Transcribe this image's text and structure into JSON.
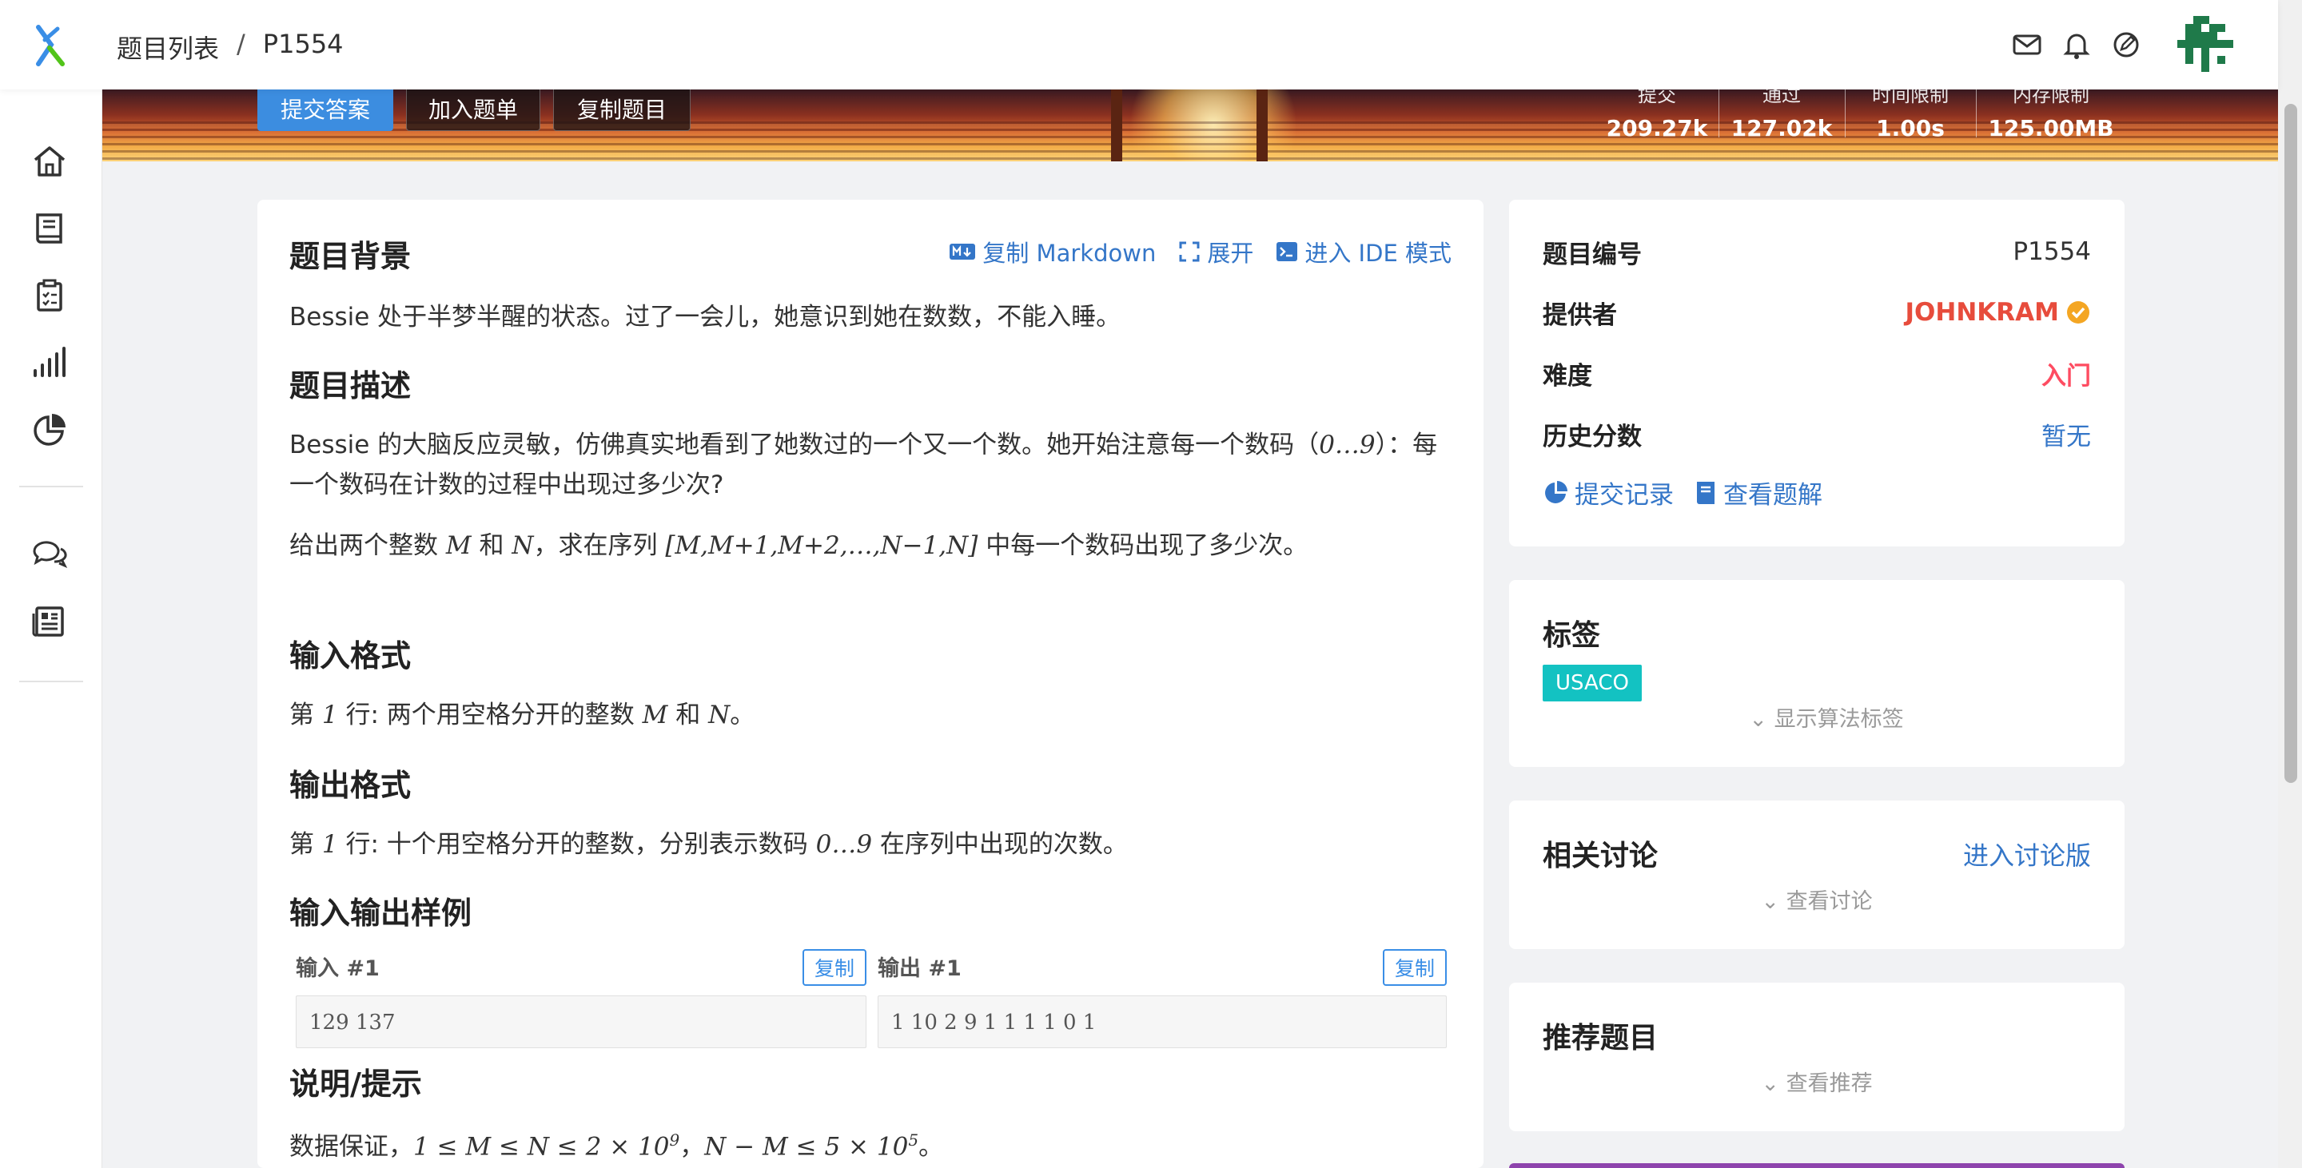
{
  "header": {
    "breadcrumb_list": "题目列表",
    "breadcrumb_sep": "/",
    "breadcrumb_current": "P1554",
    "icons": [
      "mail-icon",
      "bell-icon",
      "edit-icon"
    ]
  },
  "sidebar": {
    "items": [
      "home-icon",
      "book-icon",
      "clipboard-icon",
      "ranking-icon",
      "pie-chart-icon",
      "chat-icon",
      "news-icon"
    ]
  },
  "banner": {
    "submit_label": "提交答案",
    "add_list_label": "加入题单",
    "copy_problem_label": "复制题目",
    "stats": [
      {
        "label": "提交",
        "value": "209.27k"
      },
      {
        "label": "通过",
        "value": "127.02k"
      },
      {
        "label": "时间限制",
        "value": "1.00s"
      },
      {
        "label": "内存限制",
        "value": "125.00MB"
      }
    ]
  },
  "problem": {
    "toolbar": {
      "copy_markdown": "复制 Markdown",
      "expand": "展开",
      "ide_mode": "进入 IDE 模式"
    },
    "background_title": "题目背景",
    "background_text": "Bessie 处于半梦半醒的状态。过了一会儿，她意识到她在数数，不能入睡。",
    "description_title": "题目描述",
    "description_p1_a": "Bessie 的大脑反应灵敏，仿佛真实地看到了她数过的一个又一个数。她开始注意每一个数码（",
    "description_p1_math": "0…9",
    "description_p1_b": "）：每一个数码在计数的过程中出现过多少次?",
    "description_p2_a": "给出两个整数 ",
    "description_p2_m": "M",
    "description_p2_and": " 和 ",
    "description_p2_n": "N",
    "description_p2_b": "，求在序列 ",
    "description_p2_seq": "[M,M+1,M+2,…,N−1,N]",
    "description_p2_c": " 中每一个数码出现了多少次。",
    "input_title": "输入格式",
    "input_a": "第 ",
    "input_one": "1",
    "input_b": " 行: 两个用空格分开的整数 ",
    "input_m": "M",
    "input_and": " 和 ",
    "input_n": "N",
    "input_end": "。",
    "output_title": "输出格式",
    "output_a": "第 ",
    "output_one": "1",
    "output_b": " 行: 十个用空格分开的整数，分别表示数码 ",
    "output_math": "0…9",
    "output_c": " 在序列中出现的次数。",
    "samples_title": "输入输出样例",
    "input_label": "输入 #1",
    "output_label": "输出 #1",
    "copy_label": "复制",
    "input_value": "129 137",
    "output_value": "1 10 2 9 1 1 1 1 0 1",
    "hint_title": "说明/提示",
    "hint_a": "数据保证，",
    "hint_math1": "1 ≤ M ≤ N ≤ 2 × 10",
    "hint_sup1": "9",
    "hint_sep": "，",
    "hint_math2": "N − M ≤ 5 × 10",
    "hint_sup2": "5",
    "hint_end": "。"
  },
  "info": {
    "id_label": "题目编号",
    "id_value": "P1554",
    "provider_label": "提供者",
    "provider_value": "JOHNKRAM",
    "difficulty_label": "难度",
    "difficulty_value": "入门",
    "score_label": "历史分数",
    "score_value": "暂无",
    "records_link": "提交记录",
    "solutions_link": "查看题解"
  },
  "tags": {
    "title": "标签",
    "items": [
      "USACO"
    ],
    "show_algo": "显示算法标签"
  },
  "discuss": {
    "title": "相关讨论",
    "enter": "进入讨论版",
    "view": "查看讨论"
  },
  "recommend": {
    "title": "推荐题目",
    "view": "查看推荐"
  },
  "colors": {
    "accent": "#3476c8",
    "provider": "#e74c3c",
    "difficulty": "#fe4c61",
    "tag": "#13c2c2",
    "verified": "#f4a623"
  }
}
